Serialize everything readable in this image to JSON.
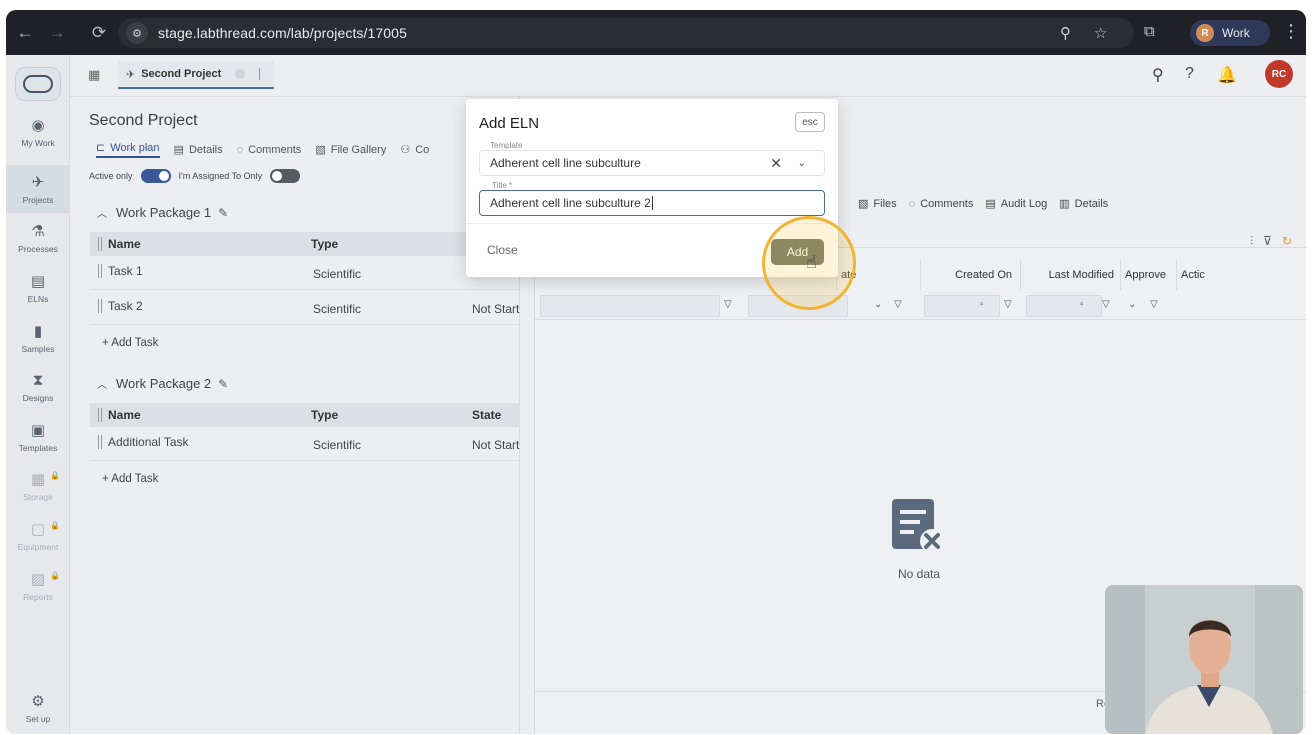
{
  "browser": {
    "url": "stage.labthread.com/lab/projects/17005",
    "profile_label": "Work",
    "profile_initial": "R"
  },
  "leftnav": {
    "items": [
      {
        "label": "My Work",
        "icon": "user-circle-icon"
      },
      {
        "label": "Projects",
        "icon": "rocket-icon"
      },
      {
        "label": "Processes",
        "icon": "flask-icon"
      },
      {
        "label": "ELNs",
        "icon": "clipboard-icon"
      },
      {
        "label": "Samples",
        "icon": "test-tube-icon"
      },
      {
        "label": "Designs",
        "icon": "hourglass-icon"
      },
      {
        "label": "Templates",
        "icon": "templates-icon"
      },
      {
        "label": "Storage",
        "icon": "storage-icon"
      },
      {
        "label": "Equipment",
        "icon": "equipment-icon"
      },
      {
        "label": "Reports",
        "icon": "reports-icon"
      },
      {
        "label": "Set up",
        "icon": "gear-icon"
      }
    ]
  },
  "topbar": {
    "tab_label": "Second Project",
    "user_initials": "RC"
  },
  "project": {
    "title": "Second Project",
    "subtabs": [
      "Work plan",
      "Details",
      "Comments",
      "File Gallery",
      "Co"
    ],
    "toggle_active_only": "Active only",
    "toggle_assigned": "I'm Assigned To Only",
    "columns": {
      "name": "Name",
      "type": "Type",
      "state": "State"
    },
    "add_task": "+ Add Task",
    "packages": [
      {
        "title": "Work Package 1",
        "tasks": [
          {
            "name": "Task 1",
            "type": "Scientific",
            "state": ""
          },
          {
            "name": "Task 2",
            "type": "Scientific",
            "state": "Not Start"
          }
        ]
      },
      {
        "title": "Work Package 2",
        "tasks": [
          {
            "name": "Additional Task",
            "type": "Scientific",
            "state": "Not Start"
          }
        ]
      }
    ]
  },
  "right": {
    "tabs": [
      "Files",
      "Comments",
      "Audit Log",
      "Details"
    ],
    "columns": [
      "ate",
      "Created On",
      "Last Modified",
      "Approve",
      "Actic"
    ],
    "no_data": "No data",
    "rows_label": "Ro"
  },
  "dialog": {
    "title": "Add ELN",
    "esc": "esc",
    "template_label": "Template",
    "template_value": "Adherent cell line subculture",
    "title_label": "Title *",
    "title_value": "Adherent cell line subculture 2",
    "close": "Close",
    "add": "Add"
  }
}
